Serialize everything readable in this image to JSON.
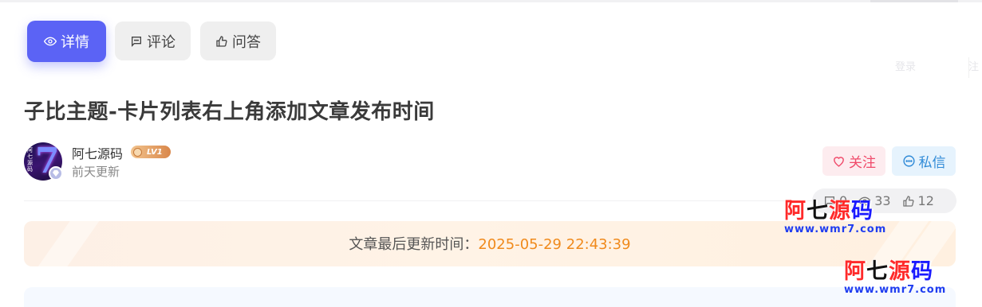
{
  "tabs": [
    {
      "label": "详情",
      "icon": "eye-icon",
      "active": true
    },
    {
      "label": "评论",
      "icon": "comment-icon",
      "active": false
    },
    {
      "label": "问答",
      "icon": "thumbs-up-icon",
      "active": false
    }
  ],
  "background_ghost": {
    "left": "登录",
    "right": "注"
  },
  "article": {
    "title": "子比主题-卡片列表右上角添加文章发布时间"
  },
  "author": {
    "name": "阿七源码",
    "level": "LV1",
    "updated": "前天更新",
    "avatar_text": "阿七源码",
    "avatar_glyph": "7"
  },
  "actions": {
    "follow_label": "关注",
    "message_label": "私信"
  },
  "stats": {
    "comments": "0",
    "views": "33",
    "likes": "12"
  },
  "update_banner": {
    "label": "文章最后更新时间：",
    "time": "2025-05-29 22:43:39"
  },
  "watermark": {
    "text": "阿七源码",
    "url": "www.wmr7.com"
  },
  "colors": {
    "accent": "#5b63f5",
    "follow": "#f04a6a",
    "message": "#2f8ad7",
    "update_time": "#f08a1c"
  }
}
